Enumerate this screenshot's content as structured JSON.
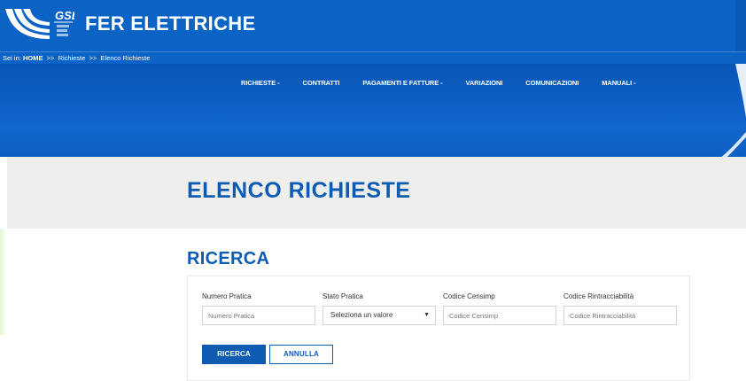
{
  "header": {
    "logo_text": "GSE",
    "logo_subtext": "Gestore Servizi Energetici",
    "app_title": "FER ELETTRICHE"
  },
  "breadcrumb": {
    "prefix": "Sei in:",
    "home": "HOME",
    "separator": ">>",
    "items": [
      "Richieste",
      "Elenco Richieste"
    ]
  },
  "nav": {
    "items": [
      {
        "label": "RICHIESTE -"
      },
      {
        "label": "CONTRATTI"
      },
      {
        "label": "PAGAMENTI E FATTURE -"
      },
      {
        "label": "VARIAZIONI"
      },
      {
        "label": "COMUNICAZIONI"
      },
      {
        "label": "MANUALI -"
      }
    ]
  },
  "page": {
    "title": "ELENCO RICHIESTE"
  },
  "search": {
    "title": "RICERCA",
    "fields": [
      {
        "label": "Numero Pratica",
        "placeholder": "Numero Pratica",
        "value": ""
      },
      {
        "label": "Stato Pratica",
        "selected": "Seleziona un valore"
      },
      {
        "label": "Codice Censimp",
        "placeholder": "Codice Censimp",
        "value": ""
      },
      {
        "label": "Codice Rintracciabilità",
        "placeholder": "Codice Rintracciabilità",
        "value": ""
      }
    ],
    "search_button": "RICERCA",
    "cancel_button": "ANNULLA"
  },
  "colors": {
    "brand_blue": "#0b63c6",
    "title_blue": "#0d5cb2",
    "band_gray": "#eeeeec"
  }
}
